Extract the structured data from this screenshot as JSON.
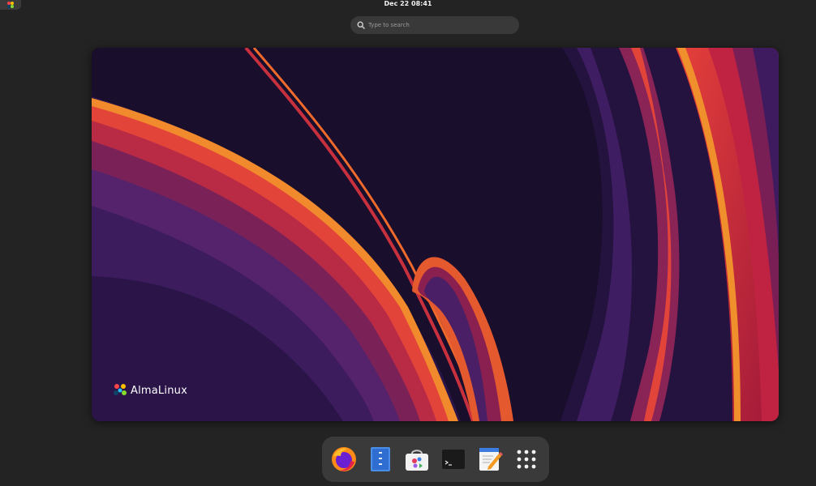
{
  "top_bar": {
    "clock": "Dec 22  08:41",
    "activities_icon": "almalinux-logo-icon"
  },
  "search": {
    "placeholder": "Type to search",
    "icon": "search-icon"
  },
  "workspace": {
    "brand_name": "AlmaLinux",
    "brand_icon": "almalinux-logo-icon"
  },
  "dash": {
    "items": [
      {
        "name": "Firefox",
        "icon": "firefox-icon"
      },
      {
        "name": "Files",
        "icon": "files-icon"
      },
      {
        "name": "Software",
        "icon": "software-store-icon"
      },
      {
        "name": "Terminal",
        "icon": "terminal-icon"
      },
      {
        "name": "Text Editor",
        "icon": "text-editor-icon"
      },
      {
        "name": "Show Applications",
        "icon": "app-grid-icon"
      }
    ]
  },
  "colors": {
    "panel_bg": "#232323",
    "dash_bg": "#3a3a3a",
    "wallpaper_base": "#190e2c",
    "accent_orange": "#f08a2c",
    "accent_red": "#d8283c",
    "accent_purple": "#5a2a7a"
  }
}
